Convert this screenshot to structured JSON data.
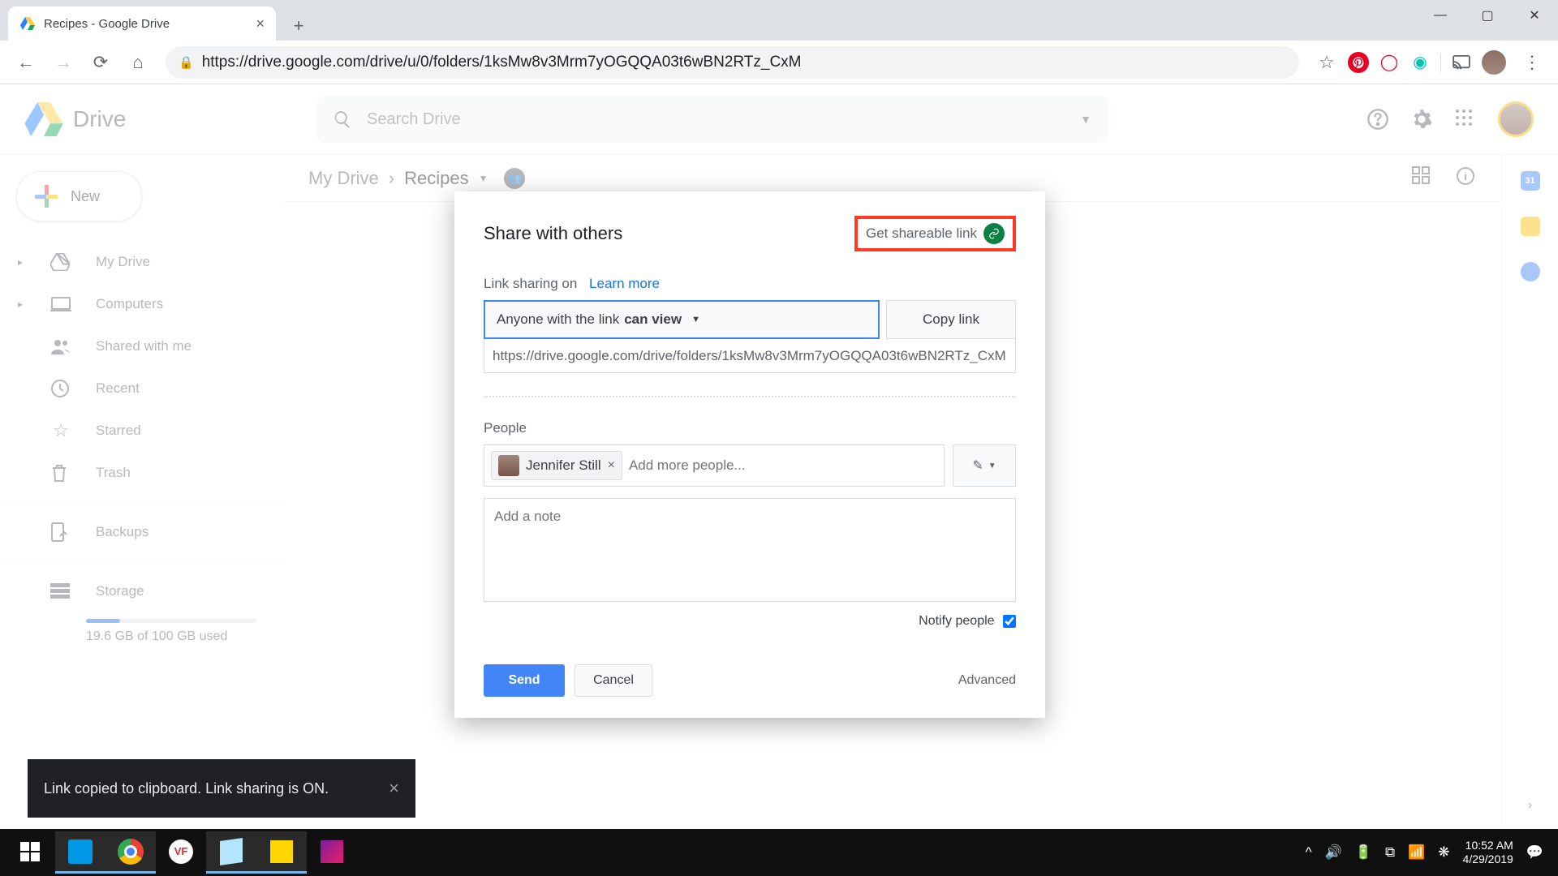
{
  "browser": {
    "tab_title": "Recipes - Google Drive",
    "url_display": "https://drive.google.com/drive/u/0/folders/1ksMw8v3Mrm7yOGQQA03t6wBN2RTz_CxM"
  },
  "drive": {
    "app_name": "Drive",
    "search_placeholder": "Search Drive",
    "new_button": "New",
    "sidebar": [
      {
        "label": "My Drive",
        "expandable": true
      },
      {
        "label": "Computers",
        "expandable": true
      },
      {
        "label": "Shared with me",
        "expandable": false
      },
      {
        "label": "Recent",
        "expandable": false
      },
      {
        "label": "Starred",
        "expandable": false
      },
      {
        "label": "Trash",
        "expandable": false
      }
    ],
    "backups_label": "Backups",
    "storage_label": "Storage",
    "storage_used": "19.6 GB of 100 GB used",
    "breadcrumb": {
      "root": "My Drive",
      "current": "Recipes"
    }
  },
  "dialog": {
    "title": "Share with others",
    "get_link": "Get shareable link",
    "status_prefix": "Link sharing on",
    "learn_more": "Learn more",
    "perm_prefix": "Anyone with the link ",
    "perm_value": "can view",
    "copy_link": "Copy link",
    "share_url": "https://drive.google.com/drive/folders/1ksMw8v3Mrm7yOGQQA03t6wBN2RTz_CxM",
    "people_label": "People",
    "person_chip": "Jennifer Still",
    "add_people_placeholder": "Add more people...",
    "note_placeholder": "Add a note",
    "notify_label": "Notify people",
    "send": "Send",
    "cancel": "Cancel",
    "advanced": "Advanced"
  },
  "toast": "Link copied to clipboard. Link sharing is ON.",
  "taskbar": {
    "time": "10:52 AM",
    "date": "4/29/2019"
  }
}
